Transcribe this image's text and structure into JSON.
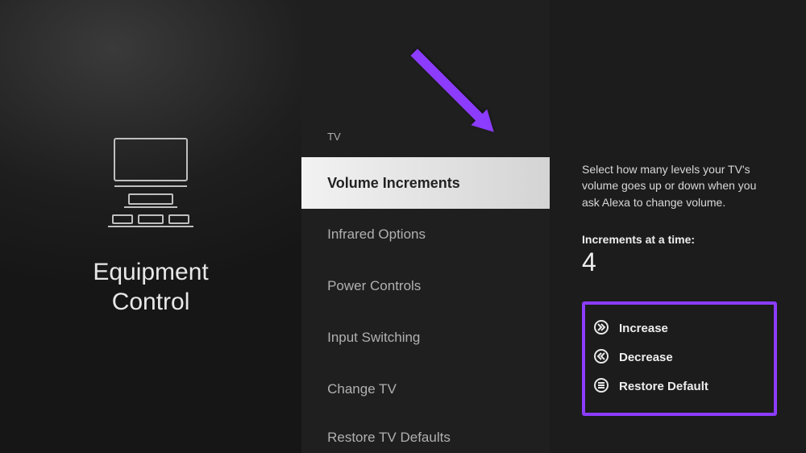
{
  "left": {
    "title_line1": "Equipment",
    "title_line2": "Control"
  },
  "menu": {
    "header": "TV",
    "items": [
      {
        "label": "Volume Increments",
        "selected": true
      },
      {
        "label": "Infrared Options"
      },
      {
        "label": "Power Controls"
      },
      {
        "label": "Input Switching"
      },
      {
        "label": "Change TV"
      },
      {
        "label": "Restore TV Defaults"
      }
    ]
  },
  "detail": {
    "description": "Select how many levels your TV's volume goes up or down when you ask Alexa to change volume.",
    "incr_label": "Increments at a time:",
    "incr_value": "4",
    "actions": {
      "increase": "Increase",
      "decrease": "Decrease",
      "restore": "Restore Default"
    }
  },
  "annotation": {
    "arrow_color": "#8c3cff"
  }
}
